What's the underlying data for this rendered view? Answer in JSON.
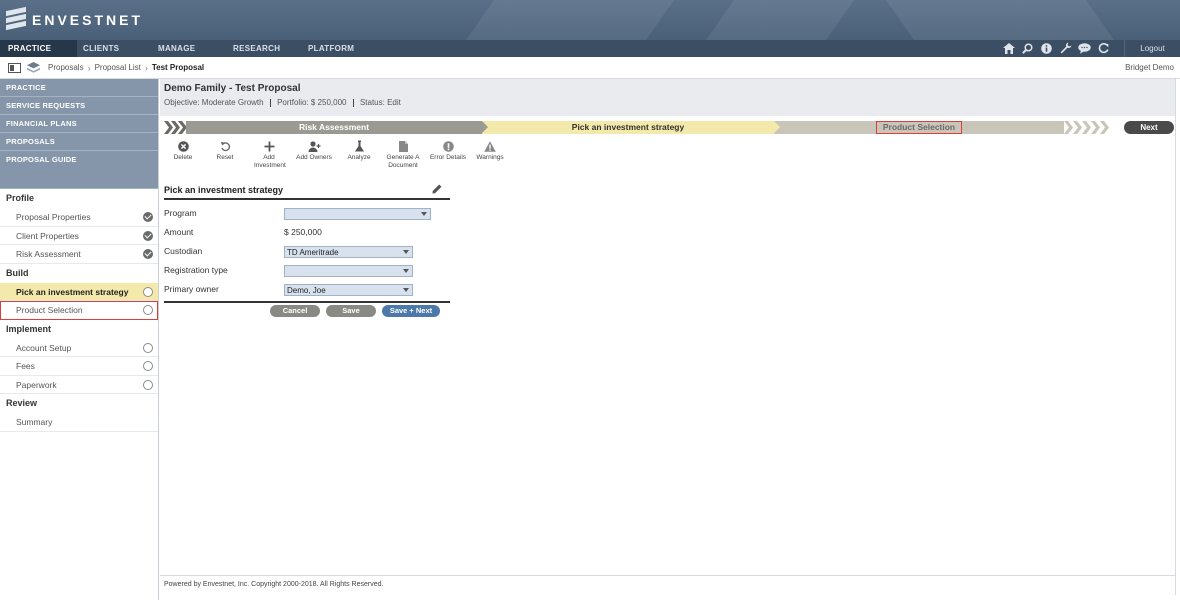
{
  "brand": {
    "name": "ENVESTNET",
    "trademark": "°"
  },
  "topnav": {
    "items": [
      {
        "label": "PRACTICE",
        "active": true
      },
      {
        "label": "CLIENTS"
      },
      {
        "label": "MANAGE"
      },
      {
        "label": "RESEARCH"
      },
      {
        "label": "PLATFORM"
      }
    ],
    "icons": [
      "home-icon",
      "search-icon",
      "info-icon",
      "wrench-icon",
      "chat-icon",
      "refresh-icon"
    ],
    "logout_label": "Logout"
  },
  "breadcrumb": {
    "items": [
      "Proposals",
      "Proposal List",
      "Test Proposal"
    ],
    "user": "Bridget Demo"
  },
  "sidebar": {
    "headers": [
      "PRACTICE",
      "SERVICE REQUESTS",
      "FINANCIAL PLANS",
      "PROPOSALS",
      "PROPOSAL GUIDE"
    ],
    "sections": {
      "profile": {
        "title": "Profile",
        "items": [
          {
            "label": "Proposal Properties",
            "status": "done"
          },
          {
            "label": "Client Properties",
            "status": "done"
          },
          {
            "label": "Risk Assessment",
            "status": "done"
          }
        ]
      },
      "build": {
        "title": "Build",
        "items": [
          {
            "label": "Pick an investment strategy",
            "status": "open",
            "active": true
          },
          {
            "label": "Product Selection",
            "status": "open",
            "highlight": true
          }
        ]
      },
      "implement": {
        "title": "Implement",
        "items": [
          {
            "label": "Account Setup",
            "status": "open"
          },
          {
            "label": "Fees",
            "status": "open"
          },
          {
            "label": "Paperwork",
            "status": "open"
          }
        ]
      },
      "review": {
        "title": "Review",
        "items": [
          {
            "label": "Summary"
          }
        ]
      }
    }
  },
  "proposal": {
    "title": "Demo Family - Test Proposal",
    "objective": "Objective: Moderate Growth",
    "portfolio": "Portfolio: $ 250,000",
    "status": "Status: Edit"
  },
  "wizard": {
    "steps": [
      "Risk Assessment",
      "Pick an investment strategy",
      "Product Selection"
    ],
    "next_label": "Next"
  },
  "toolbar": {
    "items": [
      {
        "label": "Delete",
        "icon": "delete-icon"
      },
      {
        "label": "Reset",
        "icon": "reset-icon"
      },
      {
        "label": "Add Investment",
        "icon": "plus-icon"
      },
      {
        "label": "Add Owners",
        "icon": "add-owner-icon"
      },
      {
        "label": "Analyze",
        "icon": "analyze-icon"
      },
      {
        "label": "Generate A Document",
        "icon": "document-icon"
      },
      {
        "label": "Error Details",
        "icon": "error-icon"
      },
      {
        "label": "Warnings",
        "icon": "warning-icon"
      }
    ]
  },
  "form": {
    "title": "Pick an investment strategy",
    "program": {
      "label": "Program",
      "value": ""
    },
    "amount": {
      "label": "Amount",
      "value": "$ 250,000"
    },
    "custodian": {
      "label": "Custodian",
      "value": "TD Ameritrade"
    },
    "registration": {
      "label": "Registration type",
      "value": ""
    },
    "owner": {
      "label": "Primary owner",
      "value": "Demo, Joe"
    }
  },
  "actions": {
    "cancel": "Cancel",
    "save": "Save",
    "save_next": "Save + Next"
  },
  "footer": {
    "text": "Powered by Envestnet, Inc. Copyright 2000-2018. All Rights Reserved."
  },
  "colors": {
    "header": "#4a6078",
    "nav": "#3c4e63",
    "sidebar_header": "#8596aa",
    "active_step": "#f2e9ab",
    "highlight_border": "#d9403b",
    "primary_button": "#4d79aa"
  }
}
